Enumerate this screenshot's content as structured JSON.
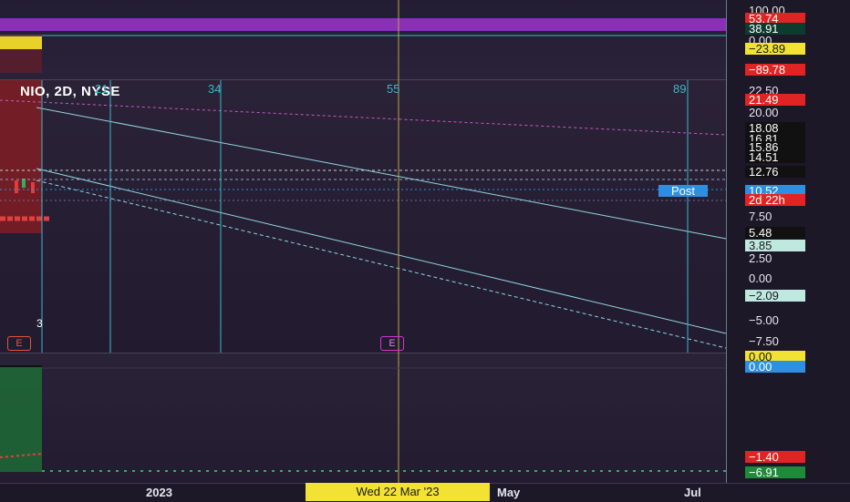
{
  "chart": {
    "title": "NIO, 2D, NYSE",
    "post_label": "Post",
    "cursor_date": "Wed 22 Mar '23",
    "earnings_marker": "E",
    "bar_count_label": "3"
  },
  "fib_labels": [
    "21",
    "34",
    "55",
    "89"
  ],
  "time_axis": [
    "2023",
    "May",
    "Jul"
  ],
  "top_pane_axis": [
    {
      "text": "100.00",
      "kind": "tick"
    },
    {
      "text": "53.74",
      "kind": "badge",
      "bg": "#e02424",
      "fg": "#ffffff"
    },
    {
      "text": "38.91",
      "kind": "badge",
      "bg": "#0d3b2e",
      "fg": "#ffffff"
    },
    {
      "text": "0.00",
      "kind": "tick"
    },
    {
      "text": "−23.89",
      "kind": "badge",
      "bg": "#f2e233",
      "fg": "#1a1a1a"
    },
    {
      "text": "−89.78",
      "kind": "badge",
      "bg": "#e02424",
      "fg": "#ffffff"
    }
  ],
  "main_pane_axis": [
    {
      "text": "22.50",
      "kind": "tick"
    },
    {
      "text": "21.49",
      "kind": "badge",
      "bg": "#e02424",
      "fg": "#ffffff"
    },
    {
      "text": "20.00",
      "kind": "tick"
    },
    {
      "text": "18.08",
      "kind": "badge",
      "bg": "#111111",
      "fg": "#ffffff"
    },
    {
      "text": "16.81",
      "kind": "badge",
      "bg": "#111111",
      "fg": "#ffffff"
    },
    {
      "text": "15.86",
      "kind": "badge",
      "bg": "#111111",
      "fg": "#ffffff"
    },
    {
      "text": "14.51",
      "kind": "badge",
      "bg": "#111111",
      "fg": "#ffffff"
    },
    {
      "text": "12.76",
      "kind": "badge",
      "bg": "#111111",
      "fg": "#ffffff"
    },
    {
      "text": "10.52",
      "kind": "badge",
      "bg": "#2e8fe0",
      "fg": "#ffffff"
    },
    {
      "text": "2d 22h",
      "kind": "badge",
      "bg": "#e02424",
      "fg": "#ffffff"
    },
    {
      "text": "7.50",
      "kind": "tick"
    },
    {
      "text": "5.48",
      "kind": "badge",
      "bg": "#111111",
      "fg": "#ffffff"
    },
    {
      "text": "3.85",
      "kind": "badge",
      "bg": "#bfe8df",
      "fg": "#1a1a1a"
    },
    {
      "text": "2.50",
      "kind": "tick"
    },
    {
      "text": "0.00",
      "kind": "tick"
    },
    {
      "text": "−2.09",
      "kind": "badge",
      "bg": "#bfe8df",
      "fg": "#1a1a1a"
    },
    {
      "text": "−5.00",
      "kind": "tick"
    },
    {
      "text": "−7.50",
      "kind": "tick"
    }
  ],
  "bottom_pane_axis": [
    {
      "text": "0.00",
      "kind": "badge",
      "bg": "#f2e233",
      "fg": "#1a1a1a"
    },
    {
      "text": "0.00",
      "kind": "badge",
      "bg": "#2e8fe0",
      "fg": "#ffffff"
    },
    {
      "text": "−1.40",
      "kind": "badge",
      "bg": "#e02424",
      "fg": "#ffffff"
    },
    {
      "text": "−6.91",
      "kind": "badge",
      "bg": "#1f8a3a",
      "fg": "#ffffff"
    }
  ],
  "colors": {
    "fib_line": "#3fb7c9",
    "channel_line": "#8fd6e0",
    "dotted_pink": "#c65ac6",
    "cursor_line": "#b8a84a"
  }
}
